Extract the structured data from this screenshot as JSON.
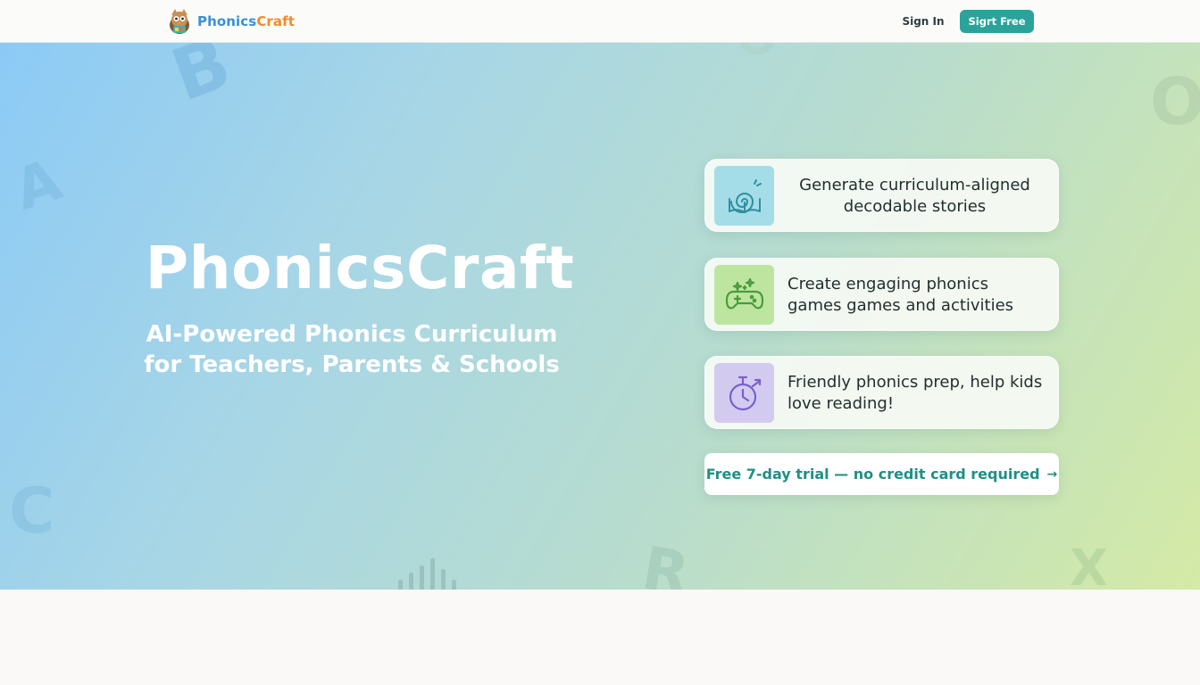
{
  "header": {
    "brand_part1": "Phonics",
    "brand_part2": "Craft",
    "sign_in": "Sign In",
    "sign_up": "Sigrt Free"
  },
  "hero": {
    "title": "PhonicsCraft",
    "subtitle_line1": "AI-Powered Phonics Curriculum",
    "subtitle_line2": "for Teachers, Parents & Schools",
    "decorative_letters": [
      "B",
      "A",
      "C",
      "R",
      "X",
      "O"
    ]
  },
  "features": [
    {
      "line1": "Generate curriculum-aligned",
      "line2": "decodable stories",
      "icon": "spiral-book-icon"
    },
    {
      "line1": "Create engaging phonics",
      "line2": "games games and activities",
      "icon": "gamepad-icon"
    },
    {
      "line1": "Friendly phonics prep, help kids",
      "line2": "love reading!",
      "icon": "stopwatch-icon"
    }
  ],
  "cta": {
    "label": "Free 7-day trial — no credit card required",
    "arrow": "→"
  },
  "colors": {
    "brand_blue": "#3a8fd6",
    "brand_orange": "#f08c2c",
    "accent_teal": "#2aa39a",
    "cta_text": "#1f8f84"
  }
}
